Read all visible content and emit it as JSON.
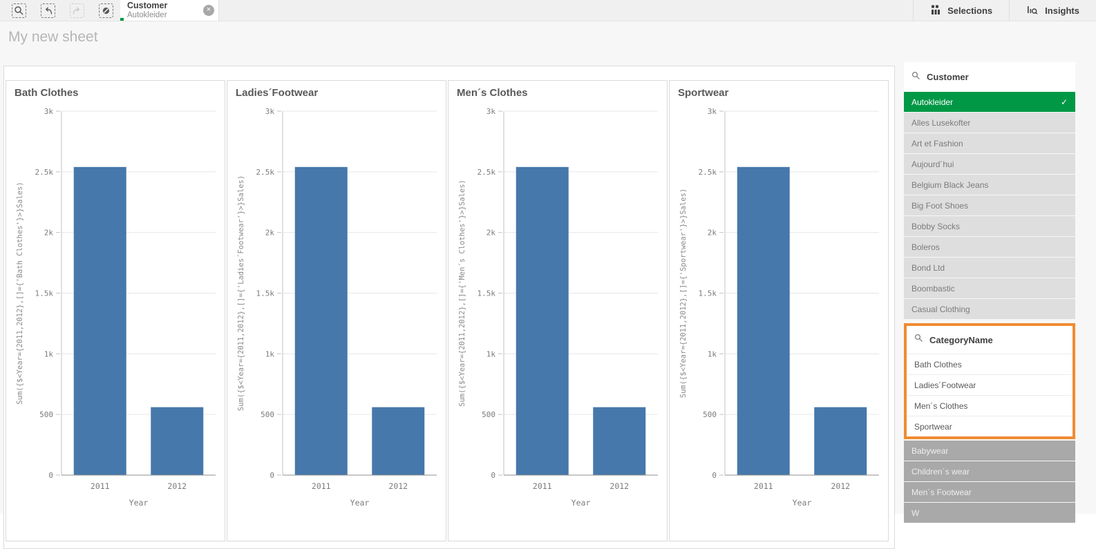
{
  "toolbar": {
    "selection_chip": {
      "field": "Customer",
      "value": "Autokleider"
    },
    "selections_label": "Selections",
    "insights_label": "Insights"
  },
  "sheet": {
    "title": "My new sheet"
  },
  "chart_data": [
    {
      "type": "bar",
      "title": "Bath Clothes",
      "categories": [
        "2011",
        "2012"
      ],
      "values": [
        2540,
        560
      ],
      "xlabel": "Year",
      "ylabel": "Sum({$<Year={2011,2012},[]={'Bath Clothes'}>}Sales)",
      "ylim": [
        0,
        3000
      ],
      "yticks": [
        [
          0,
          "0"
        ],
        [
          500,
          "500"
        ],
        [
          1000,
          "1k"
        ],
        [
          1500,
          "1.5k"
        ],
        [
          2000,
          "2k"
        ],
        [
          2500,
          "2.5k"
        ],
        [
          3000,
          "3k"
        ]
      ],
      "grid": true,
      "legend": false
    },
    {
      "type": "bar",
      "title": "Ladies´Footwear",
      "categories": [
        "2011",
        "2012"
      ],
      "values": [
        2540,
        560
      ],
      "xlabel": "Year",
      "ylabel": "Sum({$<Year={2011,2012},[]={'Ladies´Footwear'}>}Sales)",
      "ylim": [
        0,
        3000
      ],
      "yticks": [
        [
          0,
          "0"
        ],
        [
          500,
          "500"
        ],
        [
          1000,
          "1k"
        ],
        [
          1500,
          "1.5k"
        ],
        [
          2000,
          "2k"
        ],
        [
          2500,
          "2.5k"
        ],
        [
          3000,
          "3k"
        ]
      ],
      "grid": true,
      "legend": false
    },
    {
      "type": "bar",
      "title": "Men´s Clothes",
      "categories": [
        "2011",
        "2012"
      ],
      "values": [
        2540,
        560
      ],
      "xlabel": "Year",
      "ylabel": "Sum({$<Year={2011,2012},[]={'Men´s Clothes'}>}Sales)",
      "ylim": [
        0,
        3000
      ],
      "yticks": [
        [
          0,
          "0"
        ],
        [
          500,
          "500"
        ],
        [
          1000,
          "1k"
        ],
        [
          1500,
          "1.5k"
        ],
        [
          2000,
          "2k"
        ],
        [
          2500,
          "2.5k"
        ],
        [
          3000,
          "3k"
        ]
      ],
      "grid": true,
      "legend": false
    },
    {
      "type": "bar",
      "title": "Sportwear",
      "categories": [
        "2011",
        "2012"
      ],
      "values": [
        2540,
        560
      ],
      "xlabel": "Year",
      "ylabel": "Sum({$<Year={2011,2012},[]={'Sportwear'}>}Sales)",
      "ylim": [
        0,
        3000
      ],
      "yticks": [
        [
          0,
          "0"
        ],
        [
          500,
          "500"
        ],
        [
          1000,
          "1k"
        ],
        [
          1500,
          "1.5k"
        ],
        [
          2000,
          "2k"
        ],
        [
          2500,
          "2.5k"
        ],
        [
          3000,
          "3k"
        ]
      ],
      "grid": true,
      "legend": false
    }
  ],
  "sidebar": {
    "customer": {
      "field": "Customer",
      "items": [
        {
          "label": "Autokleider",
          "state": "selected"
        },
        {
          "label": "Alles Lusekofter",
          "state": "alternative"
        },
        {
          "label": "Art et Fashion",
          "state": "alternative"
        },
        {
          "label": "Aujourd´hui",
          "state": "alternative"
        },
        {
          "label": "Belgium Black Jeans",
          "state": "alternative"
        },
        {
          "label": "Big Foot Shoes",
          "state": "alternative"
        },
        {
          "label": "Bobby Socks",
          "state": "alternative"
        },
        {
          "label": "Boleros",
          "state": "alternative"
        },
        {
          "label": "Bond Ltd",
          "state": "alternative"
        },
        {
          "label": "Boombastic",
          "state": "alternative"
        },
        {
          "label": "Casual Clothing",
          "state": "alternative"
        }
      ]
    },
    "category": {
      "field": "CategoryName",
      "items": [
        {
          "label": "Bath Clothes",
          "state": "possible"
        },
        {
          "label": "Ladies´Footwear",
          "state": "possible"
        },
        {
          "label": "Men´s Clothes",
          "state": "possible"
        },
        {
          "label": "Sportwear",
          "state": "possible"
        }
      ],
      "excluded": [
        {
          "label": "Babywear",
          "state": "excluded"
        },
        {
          "label": "Children´s wear",
          "state": "excluded"
        },
        {
          "label": "Men´s Footwear",
          "state": "excluded"
        },
        {
          "label": "W",
          "state": "excluded"
        }
      ]
    }
  },
  "colors": {
    "bar": "#4678ab",
    "selected_green": "#009845",
    "focus_orange": "#f08b32",
    "alternative_gray": "#dedede",
    "excluded_gray": "#a9a9a9"
  }
}
